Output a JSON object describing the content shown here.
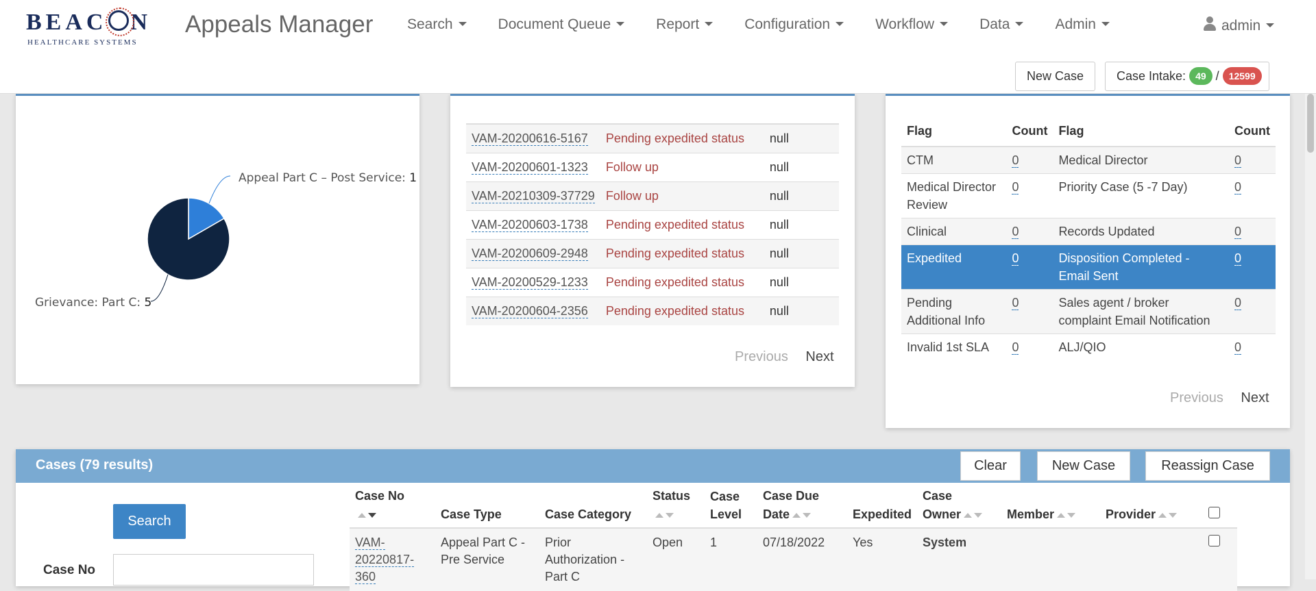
{
  "brand": {
    "logo_main": "BEAC",
    "logo_o": "O",
    "logo_end": "N",
    "logo_sub": "HEALTHCARE SYSTEMS",
    "app_title": "Appeals Manager"
  },
  "nav": {
    "items": [
      "Search",
      "Document Queue",
      "Report",
      "Configuration",
      "Workflow",
      "Data",
      "Admin"
    ],
    "user": "admin"
  },
  "actions": {
    "new_case": "New Case",
    "intake_label": "Case Intake:",
    "intake_count": "49",
    "intake_sep": "/",
    "intake_total": "12599"
  },
  "pie": {
    "labels": [
      {
        "name": "Appeal Part C – Post Service:",
        "value": "1"
      },
      {
        "name": "Grievance: Part C:",
        "value": "5"
      }
    ]
  },
  "chart_data": {
    "type": "pie",
    "categories": [
      "Appeal Part C – Post Service",
      "Grievance: Part C"
    ],
    "values": [
      1,
      5
    ],
    "colors": [
      "#2e7fd9",
      "#0f2440"
    ]
  },
  "case_list": {
    "rows": [
      {
        "id": "VAM-20200616-5167",
        "status": "Pending expedited status",
        "note": "null",
        "color": "red"
      },
      {
        "id": "VAM-20200601-1323",
        "status": "Follow up",
        "note": "null",
        "color": "red"
      },
      {
        "id": "VAM-20210309-37729",
        "status": "Follow up",
        "note": "null",
        "color": "red"
      },
      {
        "id": "VAM-20200603-1738",
        "status": "Pending expedited status",
        "note": "null",
        "color": "red"
      },
      {
        "id": "VAM-20200609-2948",
        "status": "Pending expedited status",
        "note": "null",
        "color": "red"
      },
      {
        "id": "VAM-20200529-1233",
        "status": "Pending expedited status",
        "note": "null",
        "color": "red"
      },
      {
        "id": "VAM-20200604-2356",
        "status": "Pending expedited status",
        "note": "null",
        "color": "red"
      }
    ],
    "previous": "Previous",
    "next": "Next"
  },
  "flags": {
    "headers": [
      "Flag",
      "Count",
      "Flag",
      "Count"
    ],
    "rows": [
      {
        "f1": "CTM",
        "c1": "0",
        "f2": "Medical Director",
        "c2": "0"
      },
      {
        "f1": "Medical Director Review",
        "c1": "0",
        "f2": "Priority Case (5 -7 Day)",
        "c2": "0"
      },
      {
        "f1": "Clinical",
        "c1": "0",
        "f2": "Records Updated",
        "c2": "0"
      },
      {
        "f1": "Expedited",
        "c1": "0",
        "f2": "Disposition Completed - Email Sent",
        "c2": "0"
      },
      {
        "f1": "Pending Additional Info",
        "c1": "0",
        "f2": "Sales agent / broker complaint Email Notification",
        "c2": "0"
      },
      {
        "f1": "Invalid 1st SLA",
        "c1": "0",
        "f2": "ALJ/QIO",
        "c2": "0"
      }
    ],
    "selected_index": 3,
    "previous": "Previous",
    "next": "Next"
  },
  "cases": {
    "title": "Cases (79 results)",
    "clear": "Clear",
    "new_case": "New Case",
    "reassign": "Reassign Case",
    "search": "Search",
    "case_no_label": "Case No",
    "columns": {
      "case_no": "Case No",
      "case_type": "Case Type",
      "case_category": "Case Category",
      "status": "Status",
      "case_level_1": "Case",
      "case_level_2": "Level",
      "due_1": "Case Due",
      "due_2": "Date",
      "expedited": "Expedited",
      "owner_1": "Case",
      "owner_2": "Owner",
      "member": "Member",
      "provider": "Provider"
    },
    "row": {
      "case_no": "VAM-20220817-360",
      "case_no_1": "VAM-",
      "case_no_2": "20220817-",
      "case_no_3": "360",
      "case_type_1": "Appeal Part C -",
      "case_type_2": "Pre Service",
      "category_1": "Prior",
      "category_2": "Authorization -",
      "category_3": "Part C",
      "status": "Open",
      "level": "1",
      "due": "07/18/2022",
      "expedited": "Yes",
      "owner": "System"
    }
  }
}
